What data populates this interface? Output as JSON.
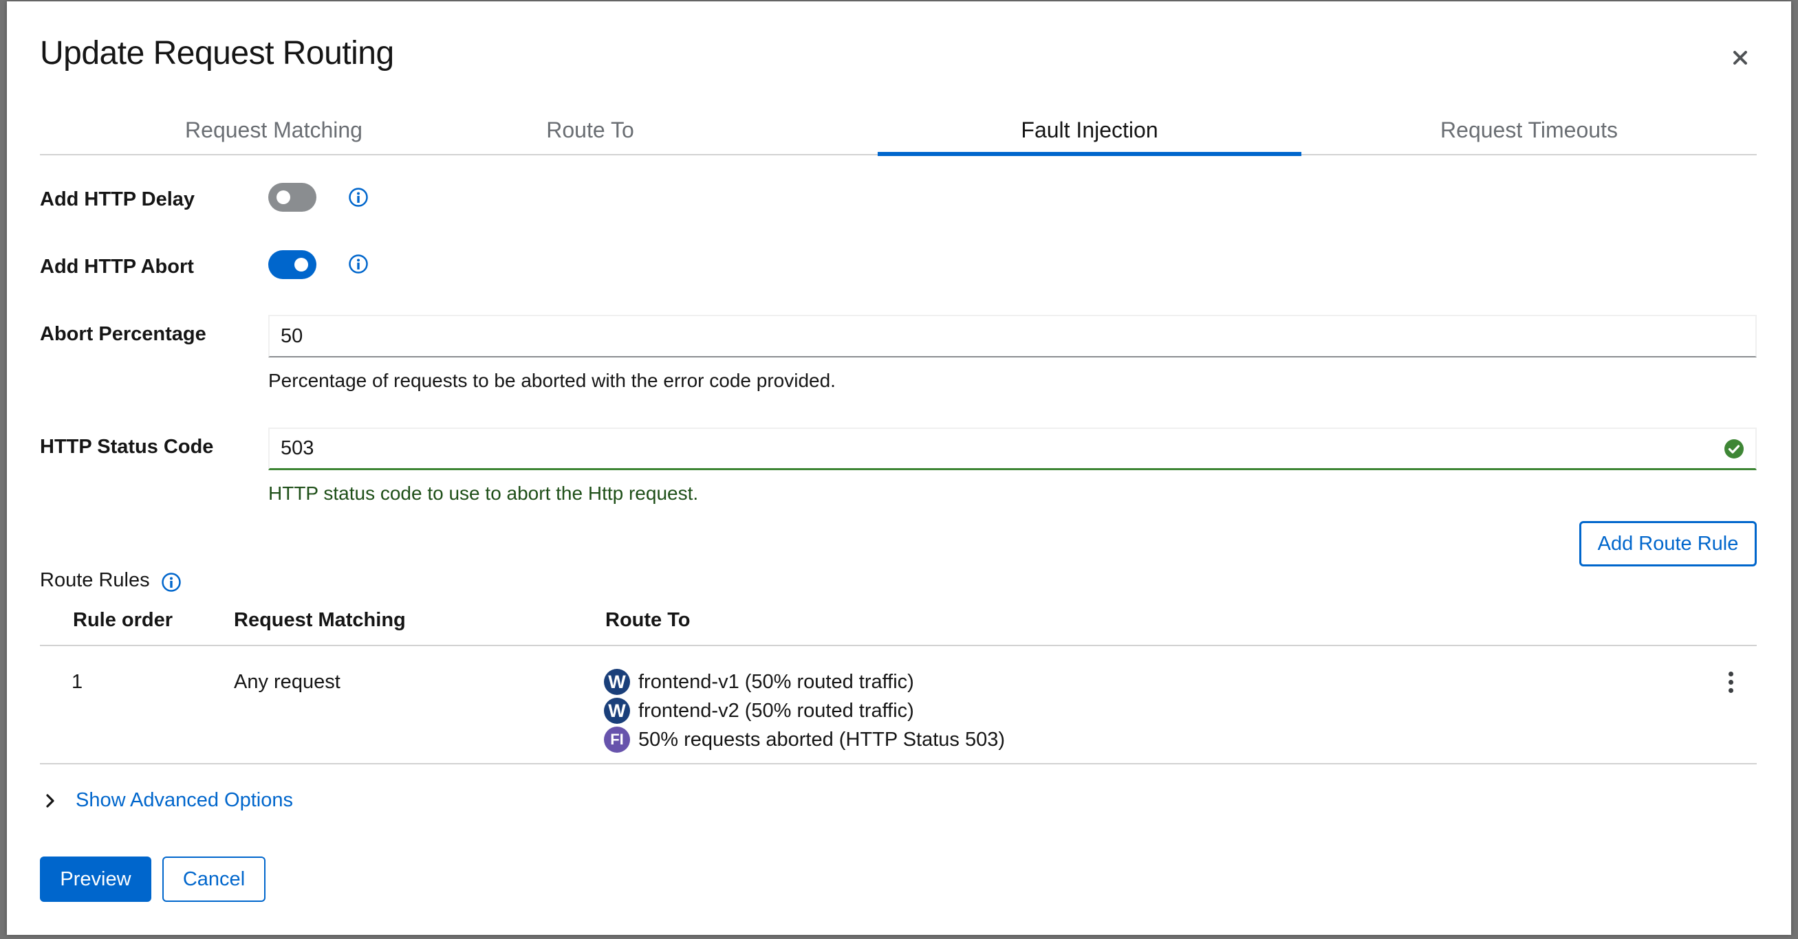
{
  "modal": {
    "title": "Update Request Routing",
    "close_icon": "close-icon"
  },
  "tabs": [
    {
      "label": "Request Matching",
      "active": false
    },
    {
      "label": "Route To",
      "active": false
    },
    {
      "label": "Fault Injection",
      "active": true
    },
    {
      "label": "Request Timeouts",
      "active": false
    }
  ],
  "form": {
    "http_delay": {
      "label": "Add HTTP Delay",
      "enabled": false,
      "icon": "info-icon"
    },
    "http_abort": {
      "label": "Add HTTP Abort",
      "enabled": true,
      "icon": "info-icon"
    },
    "abort_percentage": {
      "label": "Abort Percentage",
      "value": "50",
      "helper": "Percentage of requests to be aborted with the error code provided."
    },
    "http_status_code": {
      "label": "HTTP Status Code",
      "value": "503",
      "helper": "HTTP status code to use to abort the Http request.",
      "status_icon": "check-circle-icon"
    },
    "add_route_rule_label": "Add Route Rule"
  },
  "route_rules": {
    "title": "Route Rules",
    "info_icon": "info-icon",
    "columns": [
      "Rule order",
      "Request Matching",
      "Route To"
    ],
    "rows": [
      {
        "order": "1",
        "matching": "Any request",
        "route_to": [
          {
            "badge": "W",
            "text": "frontend-v1 (50% routed traffic)"
          },
          {
            "badge": "W",
            "text": "frontend-v2 (50% routed traffic)"
          },
          {
            "badge": "FI",
            "text": "50% requests aborted (HTTP Status 503)"
          }
        ],
        "actions_icon": "kebab-menu-icon"
      }
    ]
  },
  "advanced": {
    "label": "Show Advanced Options",
    "icon": "chevron-right-icon"
  },
  "footer": {
    "preview_label": "Preview",
    "cancel_label": "Cancel"
  },
  "colors": {
    "primary": "#0066cc",
    "success": "#3e8635",
    "badge_workload": "#1a3f7a",
    "badge_fault": "#6753ac"
  }
}
